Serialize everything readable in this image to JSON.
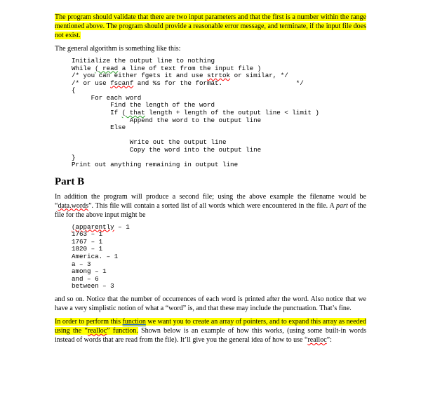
{
  "para_hl1": "The program should validate that there are two input parameters and that the first is a number within the range mentioned above. The program should provide a reasonable error message, and terminate, if the input file does not exist.",
  "para2": "The general algorithm is something like this:",
  "pseudo": {
    "l1": "Initialize the output line to nothing",
    "l2a": "While ",
    "l2b": "( read",
    "l2c": " a line of text from the input file )",
    "l3a": "/* you can either fgets it and use ",
    "l3b": "strtok",
    "l3c": " or similar, */",
    "l4a": "/* or use ",
    "l4b": "fscanf",
    "l4c": " and %s for the format.                   */",
    "l5": "{",
    "l6": "     For each word",
    "l7": "          Find the length of the word",
    "l8a": "          If ",
    "l8b": "( that",
    "l8c": " length + length of the output line < limit )",
    "l9": "               Append the word to the output line",
    "l10": "          Else",
    "l11": "",
    "l12": "               Write out the output line",
    "l13": "               Copy the word into the output line",
    "l14": "}",
    "l15": "Print out anything remaining in output line"
  },
  "partb_heading": "Part B",
  "para3a": "In addition the program will produce a second file; using the above example the filename would be “",
  "para3b": "data.words",
  "para3c": "”. This file will contain a sorted list of all words which were encountered in the file. A ",
  "para3d": "part",
  "para3e": " of the file for the above input might be",
  "wordlist": {
    "l1a": "(apparently",
    "l1b": " – 1",
    "l2": "1763 – 1",
    "l3": "1767 – 1",
    "l4": "1820 – 1",
    "l5": "America. – 1",
    "l6": "a – 3",
    "l7": "among – 1",
    "l8": "and – 6",
    "l9": "between – 3"
  },
  "para4": "and so on. Notice that the number of occurrences of each word is printed after the word. Also notice that we have a very simplistic notion of what a “word” is, and that these may include the punctuation. That’s fine.",
  "para5a": "In order to perform this ",
  "para5b": "function",
  "para5c": " we want you to create an array of pointers, and to expand this array as needed using the “",
  "para5d": "realloc",
  "para5e": "” function.",
  "para5f": " Shown below is an example of how this works, (using some built-in words instead of words that are read from the file). It’ll give you the general idea of how to use “",
  "para5g": "realloc",
  "para5h": "”:"
}
